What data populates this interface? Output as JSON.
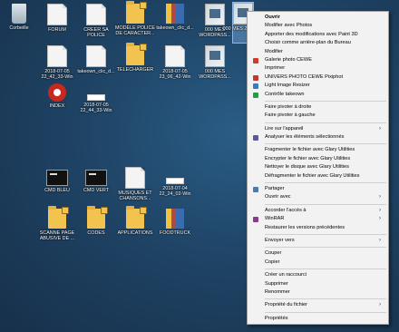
{
  "desktop_icons": [
    {
      "name": "recycle-bin",
      "label": "Corbeille",
      "type": "bin"
    },
    {
      "name": "forum",
      "label": "FORUM",
      "type": "doc"
    },
    {
      "name": "creer-sa-police",
      "label": "CREER SA POLICE",
      "type": "doc"
    },
    {
      "name": "modele-police",
      "label": "MODÈLE POLICE DE CARACTER...",
      "type": "folder-lock"
    },
    {
      "name": "takeown-clic-1",
      "label": "takeown_clic_d...",
      "type": "zip"
    },
    {
      "name": "mes-wordpass-1",
      "label": "000 MES WORDPASS...",
      "type": "img"
    },
    {
      "name": "img-2018-07-05-a",
      "label": "2018-07-05 22_42_33-Win",
      "type": "doc"
    },
    {
      "name": "takeown-clic-2",
      "label": "takeown_clic_d...",
      "type": "doc"
    },
    {
      "name": "telecharger",
      "label": "TELECHARGER",
      "type": "folder-lock"
    },
    {
      "name": "img-2018-07-05-b",
      "label": "2018-07-05 23_06_42-Win",
      "type": "doc"
    },
    {
      "name": "mes-wordpass-2",
      "label": "000 MES WORDPASS...",
      "type": "img"
    },
    {
      "name": "index",
      "label": "INDEX",
      "type": "red"
    },
    {
      "name": "img-2018-07-05-c",
      "label": "2018-07-05 22_44_33-Win",
      "type": "white"
    },
    {
      "name": "cmd-bleu",
      "label": "CMD BLEU",
      "type": "screen"
    },
    {
      "name": "cmd-vert",
      "label": "CMD VERT",
      "type": "screen"
    },
    {
      "name": "musiques",
      "label": "MUSIQUES ET CHANSONS...",
      "type": "doc"
    },
    {
      "name": "img-2018-07-04",
      "label": "2018-07-04 22_24_02-Win",
      "type": "white"
    },
    {
      "name": "scanne-page",
      "label": "SCANNE PAGE ABUSIVE DE ...",
      "type": "folder-lock"
    },
    {
      "name": "codes",
      "label": "CODES",
      "type": "folder-lock"
    },
    {
      "name": "applications",
      "label": "APPLICATIONS",
      "type": "folder-lock"
    },
    {
      "name": "foodtruck",
      "label": "FOODTRUCK",
      "type": "zip"
    }
  ],
  "selected_icon_label": "000 MES 2018_41",
  "context_menu": {
    "items": [
      {
        "label": "Ouvrir",
        "bold": true
      },
      {
        "label": "Modifier avec Photos"
      },
      {
        "label": "Apporter des modifications avec Paint 3D"
      },
      {
        "label": "Choisir comme arrière-plan du Bureau"
      },
      {
        "label": "Modifier"
      },
      {
        "label": "Galerie photo CEWE",
        "icon": "#d23a2a"
      },
      {
        "label": "Imprimer"
      },
      {
        "label": "UNIVERS PHOTO CEWE Pixiphot",
        "icon": "#c0392b"
      },
      {
        "label": "Light Image Resizer",
        "icon": "#3a7ac0"
      },
      {
        "label": "Contrôle takeown",
        "icon": "#2a9a4a"
      },
      {
        "sep": true
      },
      {
        "label": "Faire pivoter à droite"
      },
      {
        "label": "Faire pivoter à gauche"
      },
      {
        "sep": true
      },
      {
        "label": "Lire sur l'appareil",
        "arrow": true
      },
      {
        "label": "Analyser les éléments sélectionnés",
        "icon": "#5a5a9a"
      },
      {
        "sep": true
      },
      {
        "label": "Fragmenter le fichier avec Glary Utilities"
      },
      {
        "label": "Encrypter le fichier avec Glary Utilities"
      },
      {
        "label": "Nettoyer le disque avec Glary Utilities"
      },
      {
        "label": "Défragmenter le fichier avec Glary Utilities"
      },
      {
        "sep": true
      },
      {
        "label": "Partager",
        "icon": "#4a7ab0"
      },
      {
        "label": "Ouvrir avec",
        "arrow": true
      },
      {
        "sep": true
      },
      {
        "label": "Accorder l'accès à",
        "arrow": true
      },
      {
        "label": "WinRAR",
        "icon": "#8a3a8a",
        "arrow": true
      },
      {
        "label": "Restaurer les versions précédentes"
      },
      {
        "sep": true
      },
      {
        "label": "Envoyer vers",
        "arrow": true
      },
      {
        "sep": true
      },
      {
        "label": "Couper"
      },
      {
        "label": "Copier"
      },
      {
        "sep": true
      },
      {
        "label": "Créer un raccourci"
      },
      {
        "label": "Supprimer"
      },
      {
        "label": "Renommer"
      },
      {
        "sep": true
      },
      {
        "label": "Propriété du fichier",
        "arrow": true
      },
      {
        "sep": true
      },
      {
        "label": "Propriétés"
      }
    ]
  }
}
